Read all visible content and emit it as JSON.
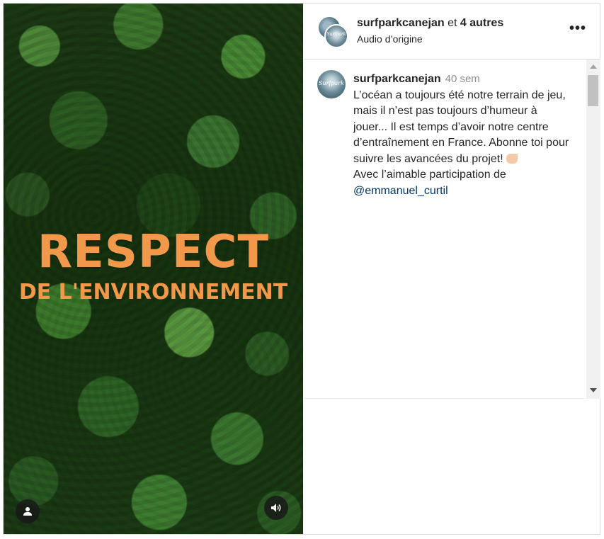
{
  "media": {
    "overlay_line1": "RESPECT",
    "overlay_line2": "DE L'ENVIRONNEMENT",
    "user_icon": "user-icon",
    "sound_icon": "speaker-icon"
  },
  "header": {
    "username": "surfparkcanejan",
    "connector": "et",
    "others": "4 autres",
    "subtitle": "Audio d’origine",
    "more_icon": "more-horizontal-icon",
    "more_label": "•••"
  },
  "caption": {
    "avatar_text": "Surfpark",
    "username": "surfparkcanejan",
    "time": "40 sem",
    "text": "L’océan a toujours été notre terrain de jeu, mais il n’est pas toujours d’humeur à jouer... Il est temps d’avoir notre centre d’entraînement en France. Abonne toi pour suivre les avancées du projet!",
    "emoji": "shaka-hand-emoji",
    "credit": "Avec l’aimable participation de",
    "mention": "@emmanuel_curtil"
  },
  "colors": {
    "overlay_text": "#f2984a",
    "mention": "#00376b",
    "muted": "#8e8e8e"
  }
}
